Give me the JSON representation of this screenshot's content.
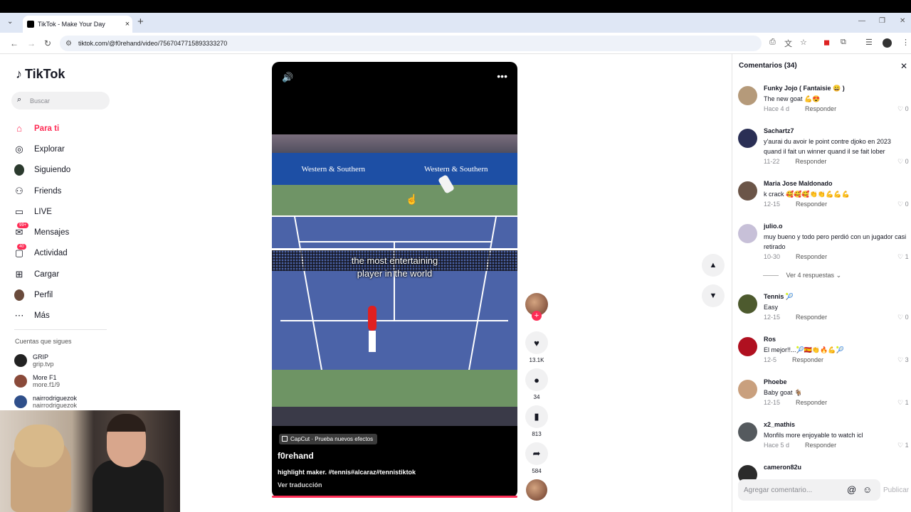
{
  "browser": {
    "tab_title": "TikTok - Make Your Day",
    "url": "tiktok.com/@f0rehand/video/7567047715893333270",
    "new_tab": "+",
    "close": "×"
  },
  "sidebar": {
    "logo": "TikTok",
    "search_placeholder": "Buscar",
    "items": [
      {
        "label": "Para ti",
        "icon": "home-icon",
        "active": true
      },
      {
        "label": "Explorar",
        "icon": "compass-icon"
      },
      {
        "label": "Siguiendo",
        "icon": "following-avatar"
      },
      {
        "label": "Friends",
        "icon": "friends-icon"
      },
      {
        "label": "LIVE",
        "icon": "live-icon"
      },
      {
        "label": "Mensajes",
        "icon": "messages-icon",
        "badge": "99+"
      },
      {
        "label": "Actividad",
        "icon": "activity-icon",
        "badge": "40"
      },
      {
        "label": "Cargar",
        "icon": "upload-icon"
      },
      {
        "label": "Perfil",
        "icon": "profile-avatar"
      },
      {
        "label": "Más",
        "icon": "more-icon"
      }
    ],
    "following_title": "Cuentas que sigues",
    "following": [
      {
        "name": "GRIP",
        "handle": "grip.tvp"
      },
      {
        "name": "More F1",
        "handle": "more.f1/9"
      },
      {
        "name": "nairrodriguezok",
        "handle": "nairrodriguezok"
      }
    ]
  },
  "video": {
    "banner_left": "Western & Southern",
    "banner_right": "Western & Southern",
    "overlay_caption_line1": "the most entertaining",
    "overlay_caption_line2": "player in the world",
    "effect_label": "CapCut · Prueba nuevos efectos",
    "author": "f0rehand",
    "description": "highlight maker. #tennis#alcaraz#tennistiktok",
    "translate": "Ver traducción"
  },
  "actions": {
    "likes": "13.1K",
    "comments": "34",
    "saves": "813",
    "shares": "584"
  },
  "comments": {
    "header": "Comentarios (34)",
    "items": [
      {
        "name": "Funky Jojo ( Fantaisie 😄 )",
        "text": "The new goat 💪😍",
        "time": "Hace 4 d",
        "reply": "Responder",
        "likes": "0",
        "avatar_color": "#b59a7a"
      },
      {
        "name": "Sachartz7",
        "text": "y'aurai du avoir le point contre djoko en 2023 quand il fait un winner quand il se fait lober",
        "time": "11-22",
        "reply": "Responder",
        "likes": "0",
        "avatar_color": "#2a2f55"
      },
      {
        "name": "Maria Jose Maldonado",
        "text": "k crack 🥰🥰🥰👏👏💪💪💪",
        "time": "12-15",
        "reply": "Responder",
        "likes": "0",
        "avatar_color": "#6b5548"
      },
      {
        "name": "julio.o",
        "text": "muy bueno y todo pero perdió con un jugador casi retirado",
        "time": "10-30",
        "reply": "Responder",
        "likes": "1",
        "avatar_color": "#c7c0d8"
      },
      {
        "name": "Tennis 🎾",
        "text": "Easy",
        "time": "12-15",
        "reply": "Responder",
        "likes": "0",
        "avatar_color": "#4d5a2e"
      },
      {
        "name": "Ros",
        "text": "El mejor!!...🎾🇪🇸👏🔥💪🎾",
        "time": "12-5",
        "reply": "Responder",
        "likes": "3",
        "avatar_color": "#b01020"
      },
      {
        "name": "Phoebe",
        "text": "Baby goat 🐐",
        "time": "12-15",
        "reply": "Responder",
        "likes": "1",
        "avatar_color": "#c9a07e"
      },
      {
        "name": "x2_mathis",
        "text": "Monfils more enjoyable to watch icl",
        "time": "Hace 5 d",
        "reply": "Responder",
        "likes": "1",
        "avatar_color": "#555a5e"
      },
      {
        "name": "cameron82u",
        "text": "",
        "time": "",
        "reply": "",
        "likes": "",
        "avatar_color": "#2b2b2b"
      }
    ],
    "view_replies": "Ver 4 respuestas",
    "input_placeholder": "Agregar comentario...",
    "publish": "Publicar"
  }
}
